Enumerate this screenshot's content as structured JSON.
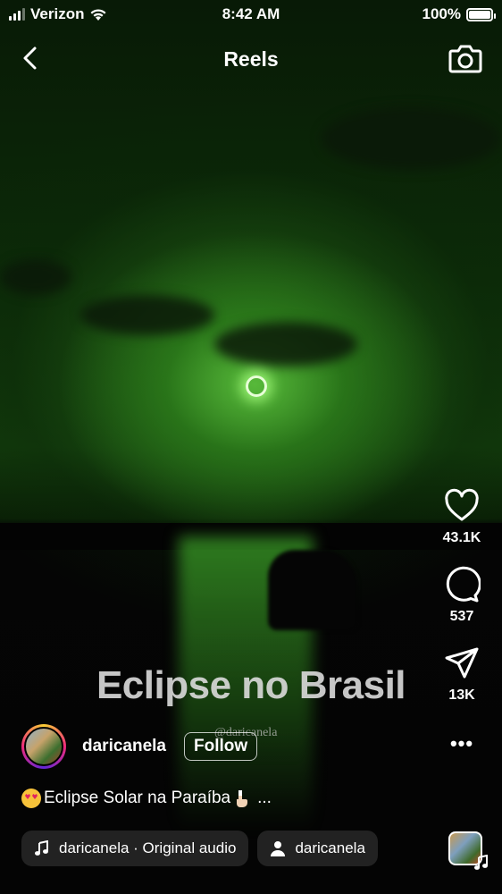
{
  "status_bar": {
    "carrier": "Verizon",
    "time": "8:42 AM",
    "battery": "100%",
    "battery_level": 1.0
  },
  "header": {
    "title": "Reels"
  },
  "video": {
    "overlay_text": "Eclipse no Brasil",
    "watermark": "@daricanela"
  },
  "actions": {
    "likes": "43.1K",
    "comments": "537",
    "shares": "13K",
    "more": "•••"
  },
  "author": {
    "username": "daricanela",
    "follow_label": "Follow"
  },
  "caption": {
    "text": "Eclipse Solar na Paraíba",
    "ellipsis": "..."
  },
  "audio": {
    "label": "daricanela · Original audio",
    "tagged_user": "daricanela"
  }
}
